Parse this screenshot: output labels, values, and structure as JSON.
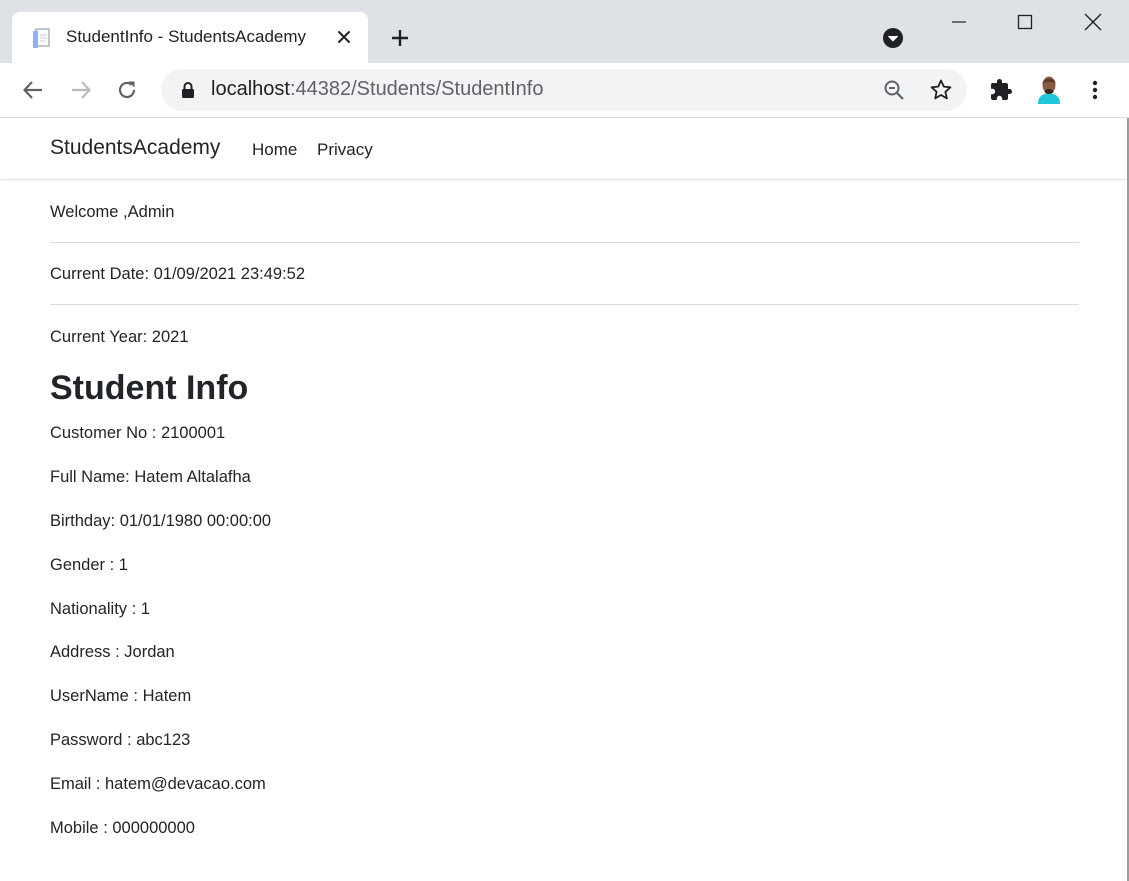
{
  "browser": {
    "tab_title": "StudentInfo - StudentsAcademy",
    "url_host": "localhost",
    "url_rest": ":44382/Students/StudentInfo",
    "icons": [
      "page-favicon-icon",
      "close-icon",
      "plus-icon",
      "tab-search-icon",
      "minimize-icon",
      "maximize-icon",
      "close-window-icon",
      "back-icon",
      "forward-icon",
      "reload-icon",
      "lock-icon",
      "zoom-icon",
      "star-icon",
      "extensions-icon",
      "profile-avatar",
      "menu-dots-icon"
    ]
  },
  "navbar": {
    "brand": "StudentsAcademy",
    "links": [
      "Home",
      "Privacy"
    ]
  },
  "header": {
    "welcome": "Welcome ,Admin",
    "current_date": "Current Date: 01/09/2021 23:49:52",
    "current_year": "Current Year: 2021"
  },
  "student": {
    "title": "Student Info",
    "fields": [
      "Customer No : 2100001",
      "Full Name: Hatem Altalafha",
      "Birthday: 01/01/1980 00:00:00",
      "Gender : 1",
      "Nationality : 1",
      "Address : Jordan",
      "UserName : Hatem",
      "Password : abc123",
      "Email : hatem@devacao.com",
      "Mobile : 000000000"
    ]
  },
  "colors": {
    "titlebar": "#dee1e6",
    "omnibox": "#f1f3f4",
    "text": "#212529"
  }
}
